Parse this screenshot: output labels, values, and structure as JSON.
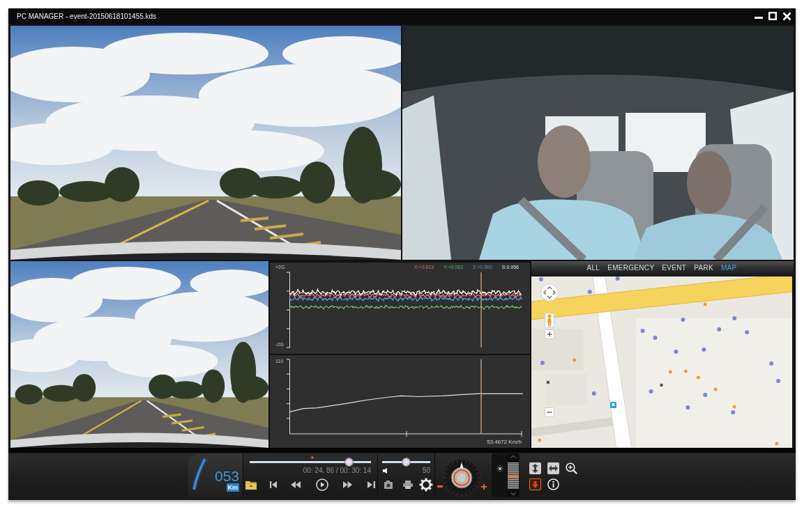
{
  "window": {
    "title": "PC MANAGER - event-20150618101455.kds"
  },
  "video_panes": [
    {
      "kind": "road"
    },
    {
      "kind": "cabin"
    },
    {
      "kind": "road"
    }
  ],
  "sensor_chart": {
    "axis_labels": [
      "+2G",
      "-2G"
    ],
    "readings": [
      {
        "label": "X:+0.813",
        "color": "#d2695e"
      },
      {
        "label": "Y:+0.063",
        "color": "#5cae62"
      },
      {
        "label": "Z:+0.500",
        "color": "#5c8fc8"
      },
      {
        "label": "S:0.956",
        "color": "#e6e6e6"
      }
    ]
  },
  "speed_chart": {
    "axis_label": "110",
    "reading": "53.4672 Km/h"
  },
  "map_panel": {
    "tabs": [
      {
        "label": "ALL",
        "selected": false
      },
      {
        "label": "EMERGENCY",
        "selected": false
      },
      {
        "label": "EVENT",
        "selected": false
      },
      {
        "label": "PARK",
        "selected": false
      },
      {
        "label": "MAP",
        "selected": true
      }
    ]
  },
  "player": {
    "speed": "053",
    "unit": "Km",
    "progress": {
      "level": 0.82,
      "time": "00: 24. 86 / 00: 30: 14"
    },
    "volume": {
      "level": 0.5,
      "reading": "50"
    },
    "brightness": {
      "level": 0.5
    }
  }
}
